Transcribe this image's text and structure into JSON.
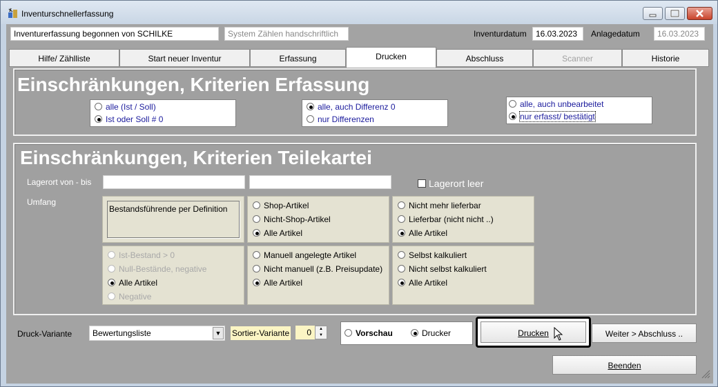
{
  "window": {
    "title": "Inventurschnellerfassung"
  },
  "header": {
    "started_by": "Inventurerfassung begonnen von SCHILKE",
    "system_hint": "System Zählen handschriftlich",
    "inventurdatum_label": "Inventurdatum",
    "inventurdatum_value": "16.03.2023",
    "anlagedatum_label": "Anlagedatum",
    "anlagedatum_value": "16.03.2023"
  },
  "tabs": [
    {
      "label": "Hilfe/ Zählliste"
    },
    {
      "label": "Start neuer Inventur"
    },
    {
      "label": "Erfassung"
    },
    {
      "label": "Drucken"
    },
    {
      "label": "Abschluss"
    },
    {
      "label": "Scanner"
    },
    {
      "label": "Historie"
    }
  ],
  "erfassung": {
    "title": "Einschränkungen, Kriterien Erfassung",
    "group1": [
      "alle (Ist / Soll)",
      "Ist oder Soll # 0"
    ],
    "group2": [
      "alle, auch Differenz 0",
      "nur Differenzen"
    ],
    "group3": [
      "alle, auch unbearbeitet",
      "nur erfasst/ bestätigt"
    ]
  },
  "teilekartei": {
    "title": "Einschränkungen, Kriterien Teilekartei",
    "lagerort_label": "Lagerort von - bis",
    "lagerort_von": "",
    "lagerort_bis": "",
    "lagerort_leer_label": "Lagerort leer",
    "umfang_label": "Umfang",
    "bestand_def": "Bestandsführende per Definition",
    "shop": [
      "Shop-Artikel",
      "Nicht-Shop-Artikel",
      "Alle Artikel"
    ],
    "lieferbar": [
      "Nicht mehr lieferbar",
      "Lieferbar (nicht nicht ..)",
      "Alle Artikel"
    ],
    "bestand": [
      "Ist-Bestand > 0",
      "Null-Bestände, negative",
      "Alle Artikel",
      "Negative"
    ],
    "manuell": [
      "Manuell angelegte Artikel",
      "Nicht manuell (z.B. Preisupdate)",
      "Alle Artikel"
    ],
    "kalkuliert": [
      "Selbst kalkuliert",
      "Nicht selbst kalkuliert",
      "Alle Artikel"
    ]
  },
  "footer": {
    "druck_variante_label": "Druck-Variante",
    "druck_variante_value": "Bewertungsliste",
    "sortier_label": "Sortier-Variante",
    "sortier_value": "0",
    "vorschau_label": "Vorschau",
    "drucker_label": "Drucker",
    "drucken_button": "Drucken",
    "weiter_button": "Weiter > Abschluss ..",
    "beenden_button": "Beenden"
  }
}
